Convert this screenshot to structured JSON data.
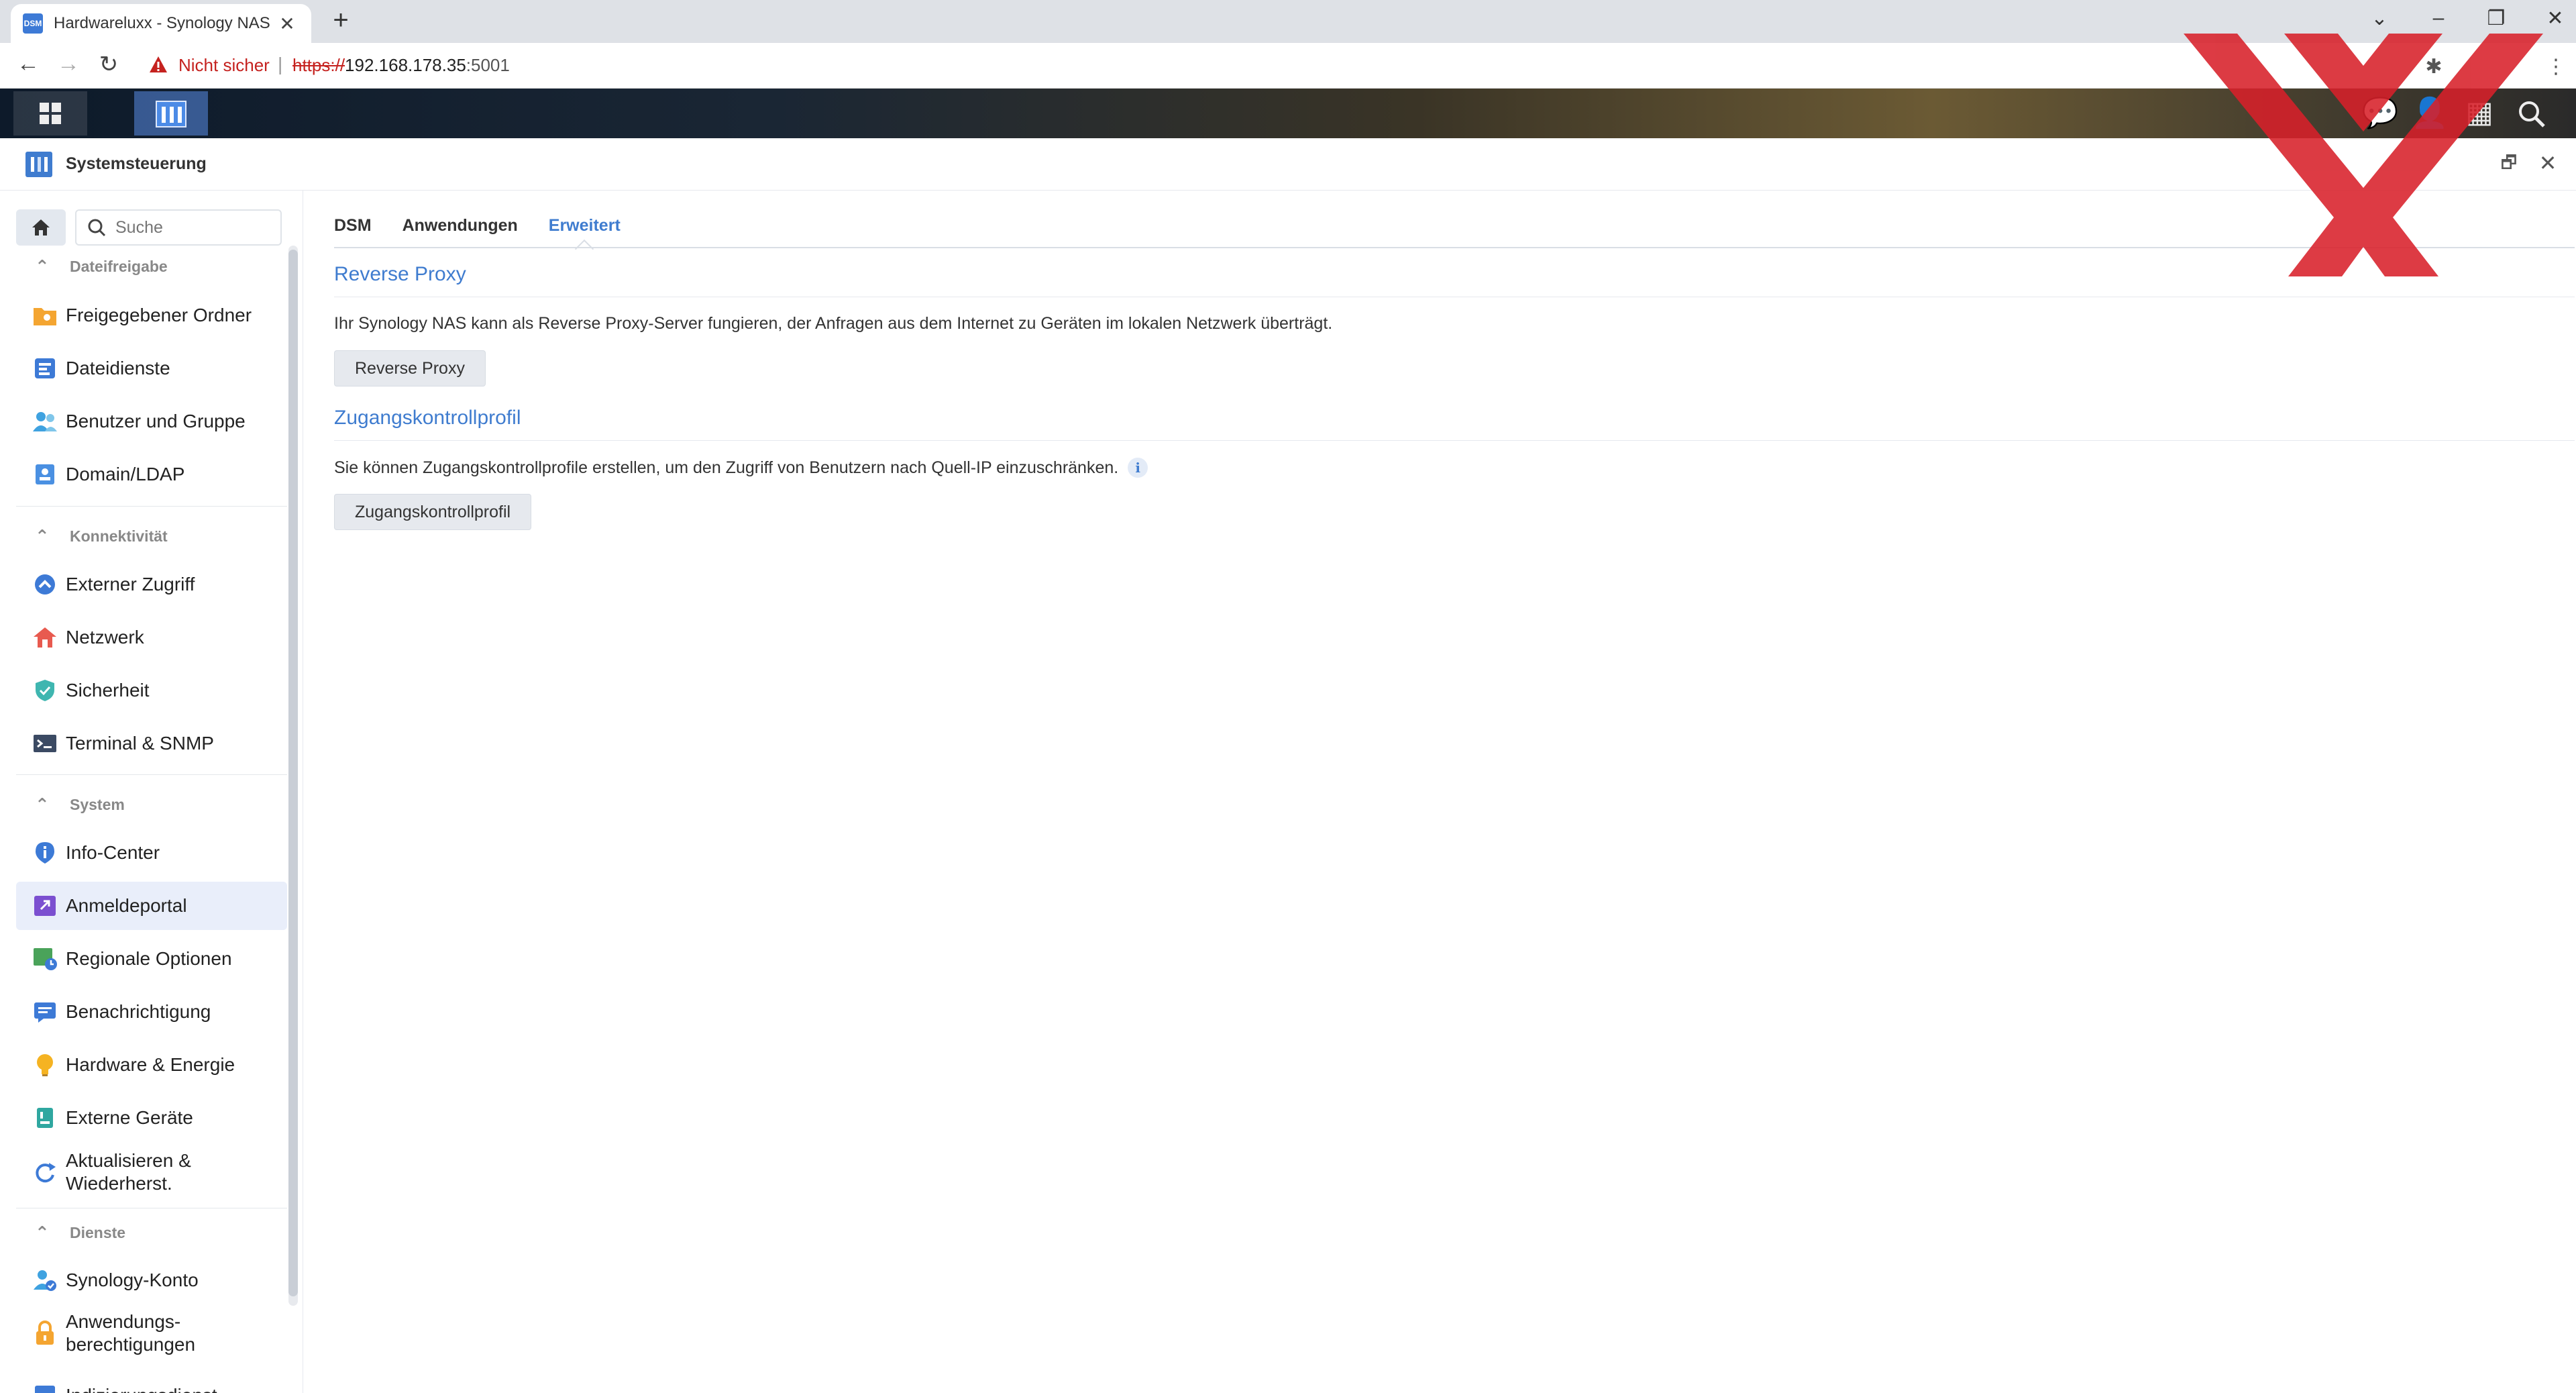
{
  "browser": {
    "tab_title": "Hardwareluxx - Synology NAS",
    "favicon_text": "DSM",
    "tab_close": "✕",
    "new_tab": "+",
    "not_secure": "Nicht sicher",
    "url_scheme": "https://",
    "url_host": "192.168.178.35",
    "url_port": ":5001",
    "minimize": "–",
    "restore": "❐",
    "close": "✕",
    "back": "←",
    "forward": "→",
    "reload": "↻",
    "menu": "⋮"
  },
  "window": {
    "title": "Systemsteuerung",
    "restore": "🗗",
    "close": "✕"
  },
  "sidebar": {
    "search_placeholder": "Suche",
    "sections": [
      {
        "title": "Dateifreigabe",
        "items": [
          {
            "label": "Freigegebener Ordner",
            "icon": "shared-folder-icon"
          },
          {
            "label": "Dateidienste",
            "icon": "file-services-icon"
          },
          {
            "label": "Benutzer und Gruppe",
            "icon": "user-group-icon"
          },
          {
            "label": "Domain/LDAP",
            "icon": "domain-ldap-icon"
          }
        ]
      },
      {
        "title": "Konnektivität",
        "items": [
          {
            "label": "Externer Zugriff",
            "icon": "external-access-icon"
          },
          {
            "label": "Netzwerk",
            "icon": "network-icon"
          },
          {
            "label": "Sicherheit",
            "icon": "security-icon"
          },
          {
            "label": "Terminal & SNMP",
            "icon": "terminal-icon"
          }
        ]
      },
      {
        "title": "System",
        "items": [
          {
            "label": "Info-Center",
            "icon": "info-center-icon"
          },
          {
            "label": "Anmeldeportal",
            "icon": "login-portal-icon",
            "active": true
          },
          {
            "label": "Regionale Optionen",
            "icon": "regional-options-icon"
          },
          {
            "label": "Benachrichtigung",
            "icon": "notification-icon"
          },
          {
            "label": "Hardware & Energie",
            "icon": "hardware-power-icon"
          },
          {
            "label": "Externe Geräte",
            "icon": "external-devices-icon"
          },
          {
            "label": "Aktualisieren & Wiederherst.",
            "icon": "update-restore-icon"
          }
        ]
      },
      {
        "title": "Dienste",
        "items": [
          {
            "label": "Synology-Konto",
            "icon": "synology-account-icon"
          },
          {
            "label": "Anwendungs-berechtigungen",
            "icon": "app-privileges-icon"
          },
          {
            "label": "Indizierungsdienst",
            "icon": "indexing-service-icon"
          }
        ]
      }
    ],
    "labels": {
      "s0": "Dateifreigabe",
      "i00": "Freigegebener Ordner",
      "i01": "Dateidienste",
      "i02": "Benutzer und Gruppe",
      "i03": "Domain/LDAP",
      "s1": "Konnektivität",
      "i10": "Externer Zugriff",
      "i11": "Netzwerk",
      "i12": "Sicherheit",
      "i13": "Terminal & SNMP",
      "s2": "System",
      "i20": "Info-Center",
      "i21": "Anmeldeportal",
      "i22": "Regionale Optionen",
      "i23": "Benachrichtigung",
      "i24": "Hardware & Energie",
      "i25": "Externe Geräte",
      "i26a": "Aktualisieren &",
      "i26b": "Wiederherst.",
      "s3": "Dienste",
      "i30": "Synology-Konto",
      "i31a": "Anwendungs-",
      "i31b": "berechtigungen",
      "i32": "Indizierungsdienst"
    }
  },
  "main": {
    "tabs": [
      "DSM",
      "Anwendungen",
      "Erweitert"
    ],
    "active_tab": "Erweitert",
    "reverse_proxy": {
      "title": "Reverse Proxy",
      "description": "Ihr Synology NAS kann als Reverse Proxy-Server fungieren, der Anfragen aus dem Internet zu Geräten im lokalen Netzwerk überträgt.",
      "button": "Reverse Proxy"
    },
    "access_control": {
      "title": "Zugangskontrollprofil",
      "description": "Sie können Zugangskontrollprofile erstellen, um den Zugriff von Benutzern nach Quell-IP einzuschränken.",
      "info": "i",
      "button": "Zugangskontrollprofil"
    }
  },
  "colors": {
    "accent": "#3f7ccf",
    "watermark": "#d8202a",
    "active_item_bg": "#e9eefa"
  }
}
